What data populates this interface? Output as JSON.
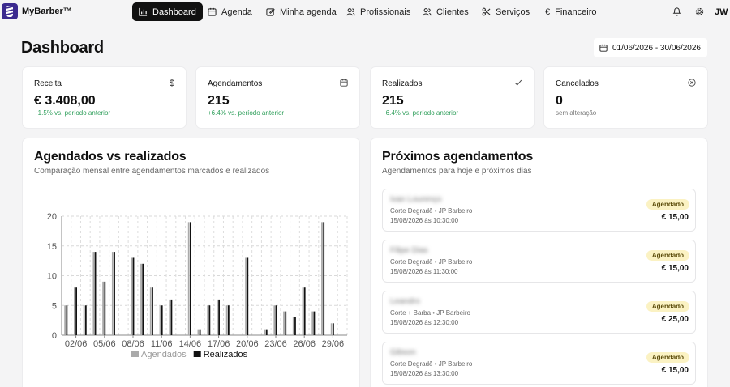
{
  "brand": {
    "name": "MyBarber™"
  },
  "nav": {
    "items": [
      {
        "label": "Dashboard",
        "icon": "bar-chart-icon",
        "active": true
      },
      {
        "label": "Agenda",
        "icon": "calendar-icon"
      },
      {
        "label": "Minha agenda",
        "icon": "edit-icon"
      },
      {
        "label": "Profissionais",
        "icon": "users-icon"
      },
      {
        "label": "Clientes",
        "icon": "users-icon"
      },
      {
        "label": "Serviços",
        "icon": "scissors-icon"
      },
      {
        "label": "Financeiro",
        "icon": "euro-icon"
      }
    ],
    "user_initials": "JW"
  },
  "header": {
    "title": "Dashboard",
    "date_range": "01/06/2026 - 30/06/2026"
  },
  "stats": [
    {
      "title": "Receita",
      "value": "€ 3.408,00",
      "sub": "+1.5% vs. período anterior",
      "icon": "dollar-icon",
      "positive": true
    },
    {
      "title": "Agendamentos",
      "value": "215",
      "sub": "+6.4% vs. período anterior",
      "icon": "calendar-icon",
      "positive": true
    },
    {
      "title": "Realizados",
      "value": "215",
      "sub": "+6.4% vs. período anterior",
      "icon": "check-icon",
      "positive": true
    },
    {
      "title": "Cancelados",
      "value": "0",
      "sub": "sem alteração",
      "icon": "x-circle-icon",
      "positive": false
    }
  ],
  "chart_panel": {
    "title": "Agendados vs realizados",
    "subtitle": "Comparação mensal entre agendamentos marcados e realizados"
  },
  "chart_data": {
    "type": "bar",
    "categories": [
      "01/06",
      "02/06",
      "03/06",
      "04/06",
      "05/06",
      "06/06",
      "07/06",
      "08/06",
      "09/06",
      "10/06",
      "11/06",
      "12/06",
      "13/06",
      "14/06",
      "15/06",
      "16/06",
      "17/06",
      "18/06",
      "19/06",
      "20/06",
      "21/06",
      "22/06",
      "23/06",
      "24/06",
      "25/06",
      "26/06",
      "27/06",
      "28/06",
      "29/06",
      "30/06"
    ],
    "tick_labels": [
      "02/06",
      "05/06",
      "08/06",
      "11/06",
      "14/06",
      "17/06",
      "20/06",
      "23/06",
      "26/06",
      "29/06"
    ],
    "series": [
      {
        "name": "Agendados",
        "color": "#aaaaaa",
        "values": [
          5,
          8,
          5,
          14,
          9,
          14,
          0,
          13,
          12,
          8,
          5,
          6,
          0,
          19,
          1,
          5,
          6,
          5,
          0,
          13,
          0,
          1,
          5,
          4,
          3,
          8,
          4,
          19,
          2,
          0
        ]
      },
      {
        "name": "Realizados",
        "color": "#111111",
        "values": [
          5,
          8,
          5,
          14,
          9,
          14,
          0,
          13,
          12,
          8,
          5,
          6,
          0,
          19,
          1,
          5,
          6,
          5,
          0,
          13,
          0,
          1,
          5,
          4,
          3,
          8,
          4,
          19,
          2,
          0
        ]
      }
    ],
    "ylim": [
      0,
      20
    ],
    "yticks": [
      0,
      5,
      10,
      15,
      20
    ],
    "grid": true,
    "legend_position": "bottom",
    "xlabel": "",
    "ylabel": ""
  },
  "appointments_panel": {
    "title": "Próximos agendamentos",
    "subtitle": "Agendamentos para hoje e próximos dias",
    "items": [
      {
        "name": "Ivan Lourenço",
        "service": "Corte Degradê • JP Barbeiro",
        "datetime": "15/08/2026 às 10:30:00",
        "status": "Agendado",
        "price": "€ 15,00"
      },
      {
        "name": "Filipe Dias",
        "service": "Corte Degradê • JP Barbeiro",
        "datetime": "15/08/2026 às 11:30:00",
        "status": "Agendado",
        "price": "€ 15,00"
      },
      {
        "name": "Leandro",
        "service": "Corte + Barba • JP Barbeiro",
        "datetime": "15/08/2026 às 12:30:00",
        "status": "Agendado",
        "price": "€ 25,00"
      },
      {
        "name": "Gibson",
        "service": "Corte Degradê • JP Barbeiro",
        "datetime": "15/08/2026 às 13:30:00",
        "status": "Agendado",
        "price": "€ 15,00"
      }
    ]
  }
}
